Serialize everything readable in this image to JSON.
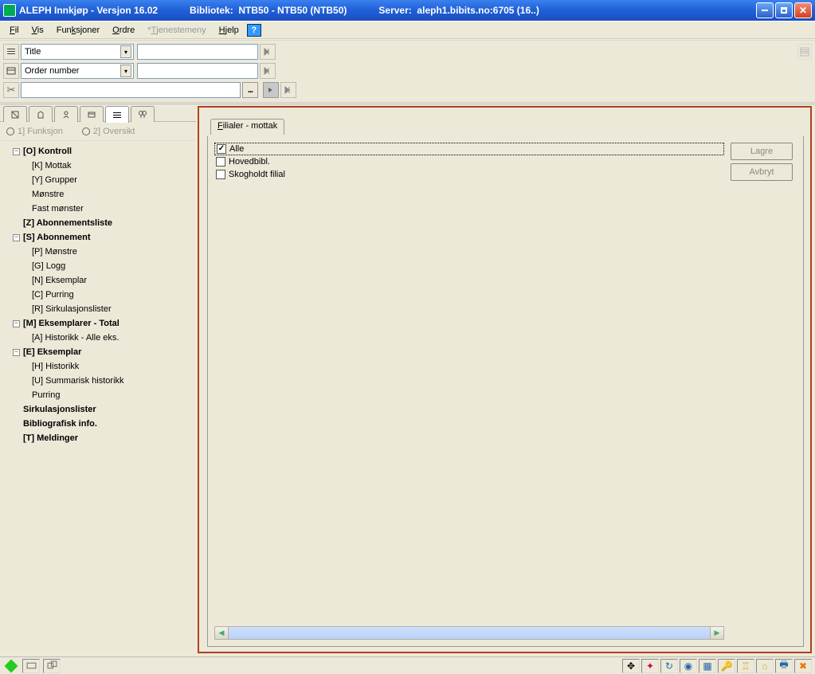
{
  "title": {
    "app": "ALEPH Innkjøp - Versjon 16.02",
    "library": "Bibliotek:  NTB50 - NTB50 (NTB50)",
    "server": "Server:  aleph1.bibits.no:6705 (16..)"
  },
  "menu": {
    "fil": "Fil",
    "vis": "Vis",
    "funksjoner": "Funksjoner",
    "ordre": "Ordre",
    "tjenestemeny": "*Tjenestemeny",
    "hjelp": "Hjelp"
  },
  "searchbar": {
    "field1": "Title",
    "field2": "Order number"
  },
  "radios": {
    "r1": "1] Funksjon",
    "r2": "2] Oversikt"
  },
  "tree": [
    {
      "lvl": 1,
      "bold": true,
      "collapse": "-",
      "label": "[O] Kontroll"
    },
    {
      "lvl": 2,
      "label": "[K] Mottak"
    },
    {
      "lvl": 2,
      "label": "[Y] Grupper"
    },
    {
      "lvl": 2,
      "label": "Mønstre"
    },
    {
      "lvl": 2,
      "label": "Fast mønster"
    },
    {
      "lvl": 1,
      "bold": true,
      "nocollapse": true,
      "label": "[Z] Abonnementsliste"
    },
    {
      "lvl": 1,
      "bold": true,
      "collapse": "-",
      "label": "[S] Abonnement"
    },
    {
      "lvl": 2,
      "label": "[P] Mønstre"
    },
    {
      "lvl": 2,
      "label": "[G] Logg"
    },
    {
      "lvl": 2,
      "label": "[N] Eksemplar"
    },
    {
      "lvl": 2,
      "label": "[C] Purring"
    },
    {
      "lvl": 2,
      "label": "[R] Sirkulasjonslister"
    },
    {
      "lvl": 1,
      "bold": true,
      "collapse": "-",
      "label": "[M] Eksemplarer - Total"
    },
    {
      "lvl": 2,
      "label": "[A] Historikk - Alle eks."
    },
    {
      "lvl": 1,
      "bold": true,
      "collapse": "-",
      "label": "[E] Eksemplar"
    },
    {
      "lvl": 2,
      "label": "[H] Historikk"
    },
    {
      "lvl": 2,
      "label": "[U] Summarisk historikk"
    },
    {
      "lvl": 2,
      "label": "Purring"
    },
    {
      "lvl": 1,
      "bold": true,
      "nocollapse": true,
      "label": "Sirkulasjonslister"
    },
    {
      "lvl": 1,
      "bold": true,
      "nocollapse": true,
      "label": "Bibliografisk info."
    },
    {
      "lvl": 1,
      "bold": true,
      "nocollapse": true,
      "label": "[T] Meldinger"
    }
  ],
  "right": {
    "tab": "Filialer - mottak",
    "items": [
      {
        "label": "Alle",
        "checked": true,
        "focused": true
      },
      {
        "label": "Hovedbibl.",
        "checked": false
      },
      {
        "label": "Skogholdt filial",
        "checked": false
      }
    ],
    "buttons": {
      "save": "Lagre",
      "cancel": "Avbryt"
    }
  }
}
